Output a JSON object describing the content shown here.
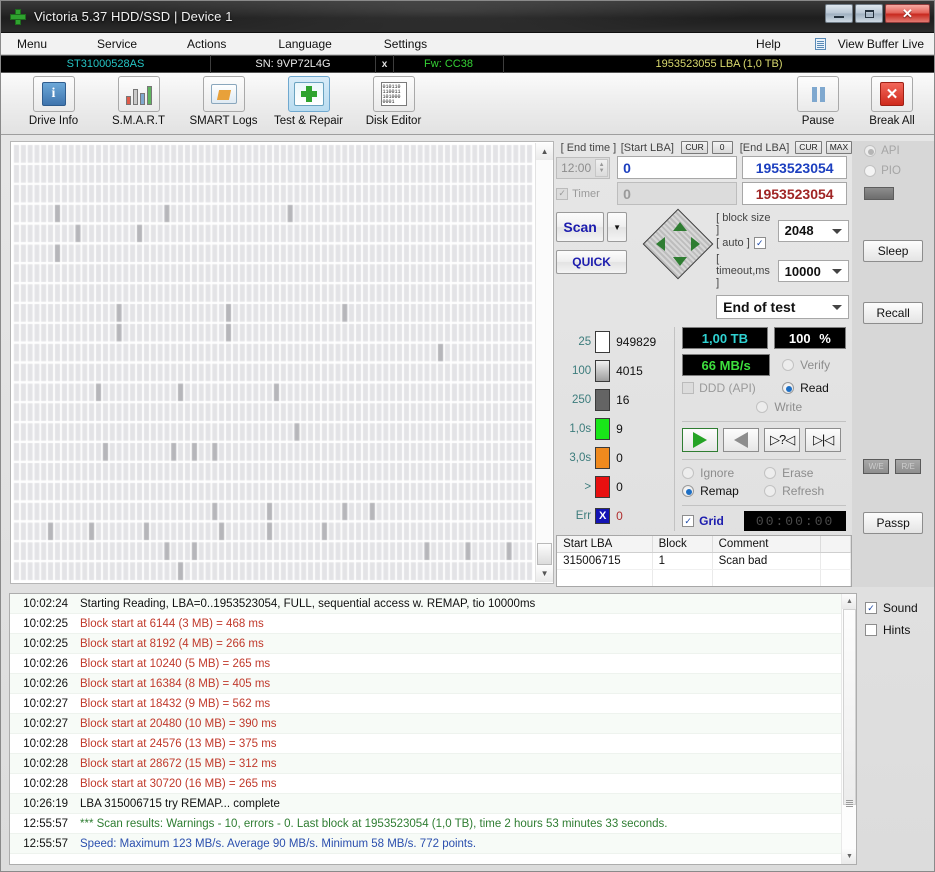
{
  "window": {
    "title": "Victoria 5.37 HDD/SSD | Device 1",
    "icon": "green-cross-icon",
    "minimize": "–",
    "maximize": "□",
    "close": "✕"
  },
  "menubar": {
    "items": [
      "Menu",
      "Service",
      "Actions",
      "Language",
      "Settings"
    ],
    "help": "Help",
    "view_buffer_live": "View Buffer Live"
  },
  "driveinfo": {
    "model": "ST31000528AS",
    "serial": "SN: 9VP72L4G",
    "x": "x",
    "firmware": "Fw: CC38",
    "capacity": "1953523055 LBA (1,0 TB)"
  },
  "toolbar": {
    "items": [
      {
        "label": "Drive Info",
        "icon": "info-icon",
        "selected": false
      },
      {
        "label": "S.M.A.R.T",
        "icon": "bar-chart-icon",
        "selected": false
      },
      {
        "label": "SMART Logs",
        "icon": "folder-icon",
        "selected": false
      },
      {
        "label": "Test & Repair",
        "icon": "repair-cross-icon",
        "selected": true
      },
      {
        "label": "Disk Editor",
        "icon": "hex-page-icon",
        "selected": false
      }
    ],
    "pause": {
      "label": "Pause",
      "icon": "pause-icon"
    },
    "break_all": {
      "label": "Break All",
      "icon": "red-x-icon"
    }
  },
  "scan_params": {
    "end_time_label": "[ End time ]",
    "end_time_value": "12:00",
    "timer_label": "Timer",
    "timer_checked": true,
    "start_lba_label": "[Start LBA]",
    "start_lba_cur": "CUR",
    "start_lba_zero": "0",
    "start_lba_value": "0",
    "start_lba_value2": "0",
    "end_lba_label": "[End LBA]",
    "end_lba_cur": "CUR",
    "end_lba_max": "MAX",
    "end_lba_value": "1953523054",
    "end_lba_value2": "1953523054",
    "scan_button": "Scan",
    "quick_button": "QUICK",
    "block_size_label": "[ block size ]",
    "block_size_value": "2048",
    "auto_label": "[ auto ]",
    "auto_checked": true,
    "timeout_label": "[ timeout,ms ]",
    "timeout_value": "10000",
    "end_of_test_value": "End of test",
    "nav_icons": [
      "nav-up-icon",
      "nav-left-icon",
      "nav-right-icon",
      "nav-down-icon"
    ]
  },
  "legend": {
    "rows": [
      {
        "key": "25",
        "color": "#ffffff",
        "count": "949829"
      },
      {
        "key": "100",
        "color": "#a8a8a8",
        "count": "4015"
      },
      {
        "key": "250",
        "color": "#646464",
        "count": "16"
      },
      {
        "key": "1,0s",
        "color": "#19e619",
        "count": "9"
      },
      {
        "key": "3,0s",
        "color": "#f08a1e",
        "count": "0"
      },
      {
        "key": ">",
        "color": "#e81010",
        "count": "0"
      },
      {
        "key": "Err",
        "color": "#1414b4",
        "count": "0",
        "glyph": "X"
      }
    ]
  },
  "status": {
    "capacity": "1,00 TB",
    "percent_value": "100",
    "percent_sign": "%",
    "speed": "66 MB/s",
    "ddd_label": "DDD (API)",
    "ddd_checked": false,
    "modes": [
      {
        "label": "Verify",
        "selected": false
      },
      {
        "label": "Read",
        "selected": true
      },
      {
        "label": "Write",
        "selected": false
      }
    ],
    "transport": [
      {
        "name": "play-icon",
        "glyph": "▶"
      },
      {
        "name": "reverse-icon",
        "glyph": "◀"
      },
      {
        "name": "random-icon",
        "glyph": "▷?◁"
      },
      {
        "name": "skip-start-icon",
        "glyph": "▷|◁"
      }
    ],
    "actions": [
      {
        "label": "Ignore",
        "selected": false
      },
      {
        "label": "Erase",
        "selected": false
      },
      {
        "label": "Remap",
        "selected": true
      },
      {
        "label": "Refresh",
        "selected": false
      }
    ],
    "grid_label": "Grid",
    "grid_checked": true,
    "elapsed": "00:00:00"
  },
  "defects_table": {
    "columns": [
      "Start LBA",
      "Block",
      "Comment"
    ],
    "rows": [
      {
        "start_lba": "315006715",
        "block": "1",
        "comment": "Scan bad"
      }
    ]
  },
  "right_rail": {
    "api_label": "API",
    "api_selected": true,
    "pio_label": "PIO",
    "pio_selected": false,
    "sleep": "Sleep",
    "recall": "Recall",
    "small_left": "W/E",
    "small_right": "R/E",
    "passport": "Passp"
  },
  "log": {
    "lines": [
      {
        "time": "10:02:24",
        "text": "Starting Reading, LBA=0..1953523054, FULL, sequential access w. REMAP, tio 10000ms",
        "color": "black"
      },
      {
        "time": "10:02:25",
        "text": "Block start at 6144 (3 MB)  = 468 ms",
        "color": "red"
      },
      {
        "time": "10:02:25",
        "text": "Block start at 8192 (4 MB)  = 266 ms",
        "color": "red"
      },
      {
        "time": "10:02:26",
        "text": "Block start at 10240 (5 MB)  = 265 ms",
        "color": "red"
      },
      {
        "time": "10:02:26",
        "text": "Block start at 16384 (8 MB)  = 405 ms",
        "color": "red"
      },
      {
        "time": "10:02:27",
        "text": "Block start at 18432 (9 MB)  = 562 ms",
        "color": "red"
      },
      {
        "time": "10:02:27",
        "text": "Block start at 20480 (10 MB)  = 390 ms",
        "color": "red"
      },
      {
        "time": "10:02:28",
        "text": "Block start at 24576 (13 MB)  = 375 ms",
        "color": "red"
      },
      {
        "time": "10:02:28",
        "text": "Block start at 28672 (15 MB)  = 312 ms",
        "color": "red"
      },
      {
        "time": "10:02:28",
        "text": "Block start at 30720 (16 MB)  = 265 ms",
        "color": "red"
      },
      {
        "time": "10:26:19",
        "text": "LBA 315006715 try REMAP... complete",
        "color": "black"
      },
      {
        "time": "12:55:57",
        "text": "*** Scan results: Warnings - 10, errors - 0. Last block at 1953523054 (1,0 TB), time 2 hours 53 minutes 33 seconds.",
        "color": "green"
      },
      {
        "time": "12:55:57",
        "text": "Speed: Maximum 123 MB/s. Average 90 MB/s. Minimum 58 MB/s. 772 points.",
        "color": "blue"
      }
    ],
    "sound_label": "Sound",
    "sound_checked": true,
    "hints_label": "Hints",
    "hints_checked": false
  },
  "surface_map": {
    "cols": 48,
    "rows": 15,
    "cell_base_color": "#e3e3e6",
    "cell_slow_color": "#b6b6ba",
    "grid_line_color": "#ffffff",
    "slow_cells": [
      [
        3,
        6
      ],
      [
        3,
        22
      ],
      [
        3,
        40
      ],
      [
        4,
        9
      ],
      [
        4,
        18
      ],
      [
        5,
        6
      ],
      [
        8,
        15
      ],
      [
        8,
        31
      ],
      [
        8,
        48
      ],
      [
        9,
        15
      ],
      [
        9,
        31
      ],
      [
        10,
        62
      ],
      [
        12,
        12
      ],
      [
        12,
        24
      ],
      [
        12,
        38
      ],
      [
        14,
        41
      ],
      [
        15,
        13
      ],
      [
        15,
        23
      ],
      [
        15,
        26
      ],
      [
        15,
        29
      ],
      [
        18,
        29
      ],
      [
        18,
        37
      ],
      [
        18,
        48
      ],
      [
        18,
        52
      ],
      [
        19,
        5
      ],
      [
        19,
        11
      ],
      [
        19,
        19
      ],
      [
        19,
        30
      ],
      [
        19,
        37
      ],
      [
        19,
        45
      ],
      [
        20,
        22
      ],
      [
        20,
        26
      ],
      [
        20,
        60
      ],
      [
        20,
        66
      ],
      [
        20,
        72
      ],
      [
        21,
        24
      ]
    ]
  }
}
